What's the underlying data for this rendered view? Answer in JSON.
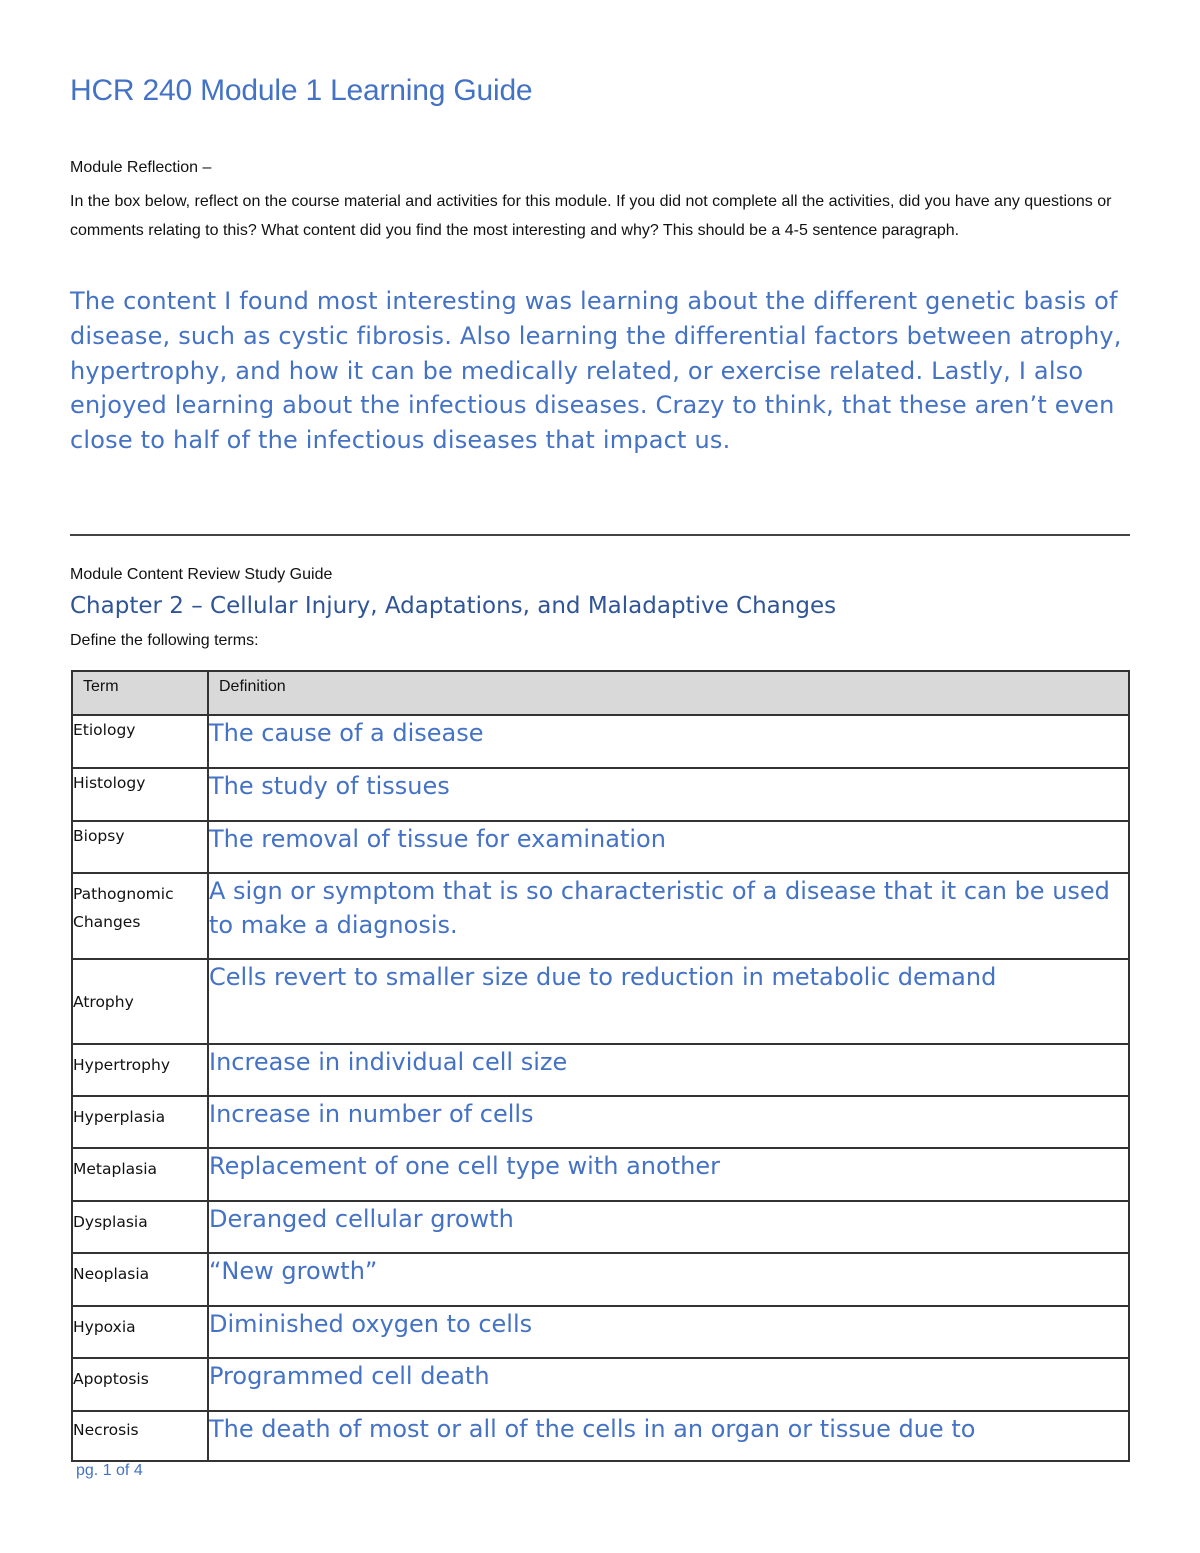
{
  "document": {
    "title": "HCR 240 Module 1 Learning Guide",
    "reflection": {
      "label": "Module Reflection –",
      "instructions": "In the box below, reflect on the course material and activities for this module. If you did not complete all the activities, did you have any questions or comments relating to this? What content did you find the most interesting and why? This should be a 4-5 sentence paragraph.",
      "answer": "The content I found most interesting was learning about the different genetic basis of disease, such as cystic fibrosis. Also learning the differential factors between atrophy, hypertrophy, and how it can be medically related, or exercise related. Lastly, I also enjoyed learning about the infectious diseases. Crazy to think, that these aren’t even close to half of the infectious diseases that impact us."
    },
    "review": {
      "label": "Module Content Review Study Guide",
      "chapter_title": "Chapter 2 – Cellular Injury, Adaptations, and Maladaptive Changes",
      "define_prompt": "Define the following terms:",
      "table": {
        "headers": [
          "Term",
          "Definition"
        ],
        "rows": [
          {
            "term": "Etiology",
            "definition": "The cause of a disease"
          },
          {
            "term": "Histology",
            "definition": "The study of tissues"
          },
          {
            "term": "Biopsy",
            "definition": "The removal of tissue for examination"
          },
          {
            "term": "Pathognomic Changes",
            "definition": "A sign or symptom that is so characteristic of a disease that it can be used to make a diagnosis."
          },
          {
            "term": "Atrophy",
            "definition": "Cells revert to smaller size due to reduction in metabolic demand"
          },
          {
            "term": "Hypertrophy",
            "definition": "Increase in individual cell size"
          },
          {
            "term": "Hyperplasia",
            "definition": "Increase in number of cells"
          },
          {
            "term": "Metaplasia",
            "definition": "Replacement of one cell type with another"
          },
          {
            "term": "Dysplasia",
            "definition": "Deranged cellular growth"
          },
          {
            "term": "Neoplasia",
            "definition": "“New growth”"
          },
          {
            "term": "Hypoxia",
            "definition": "Diminished oxygen to cells"
          },
          {
            "term": "Apoptosis",
            "definition": "Programmed cell death"
          },
          {
            "term": "Necrosis",
            "definition": "The death of most or all of the cells in an organ or tissue due to"
          }
        ]
      }
    },
    "footer": {
      "page_indicator": "pg. 1 of 4"
    },
    "colors": {
      "accent_blue": "#4472c4",
      "heading_blue": "#2f5597",
      "header_gray": "#d9d9d9"
    }
  }
}
